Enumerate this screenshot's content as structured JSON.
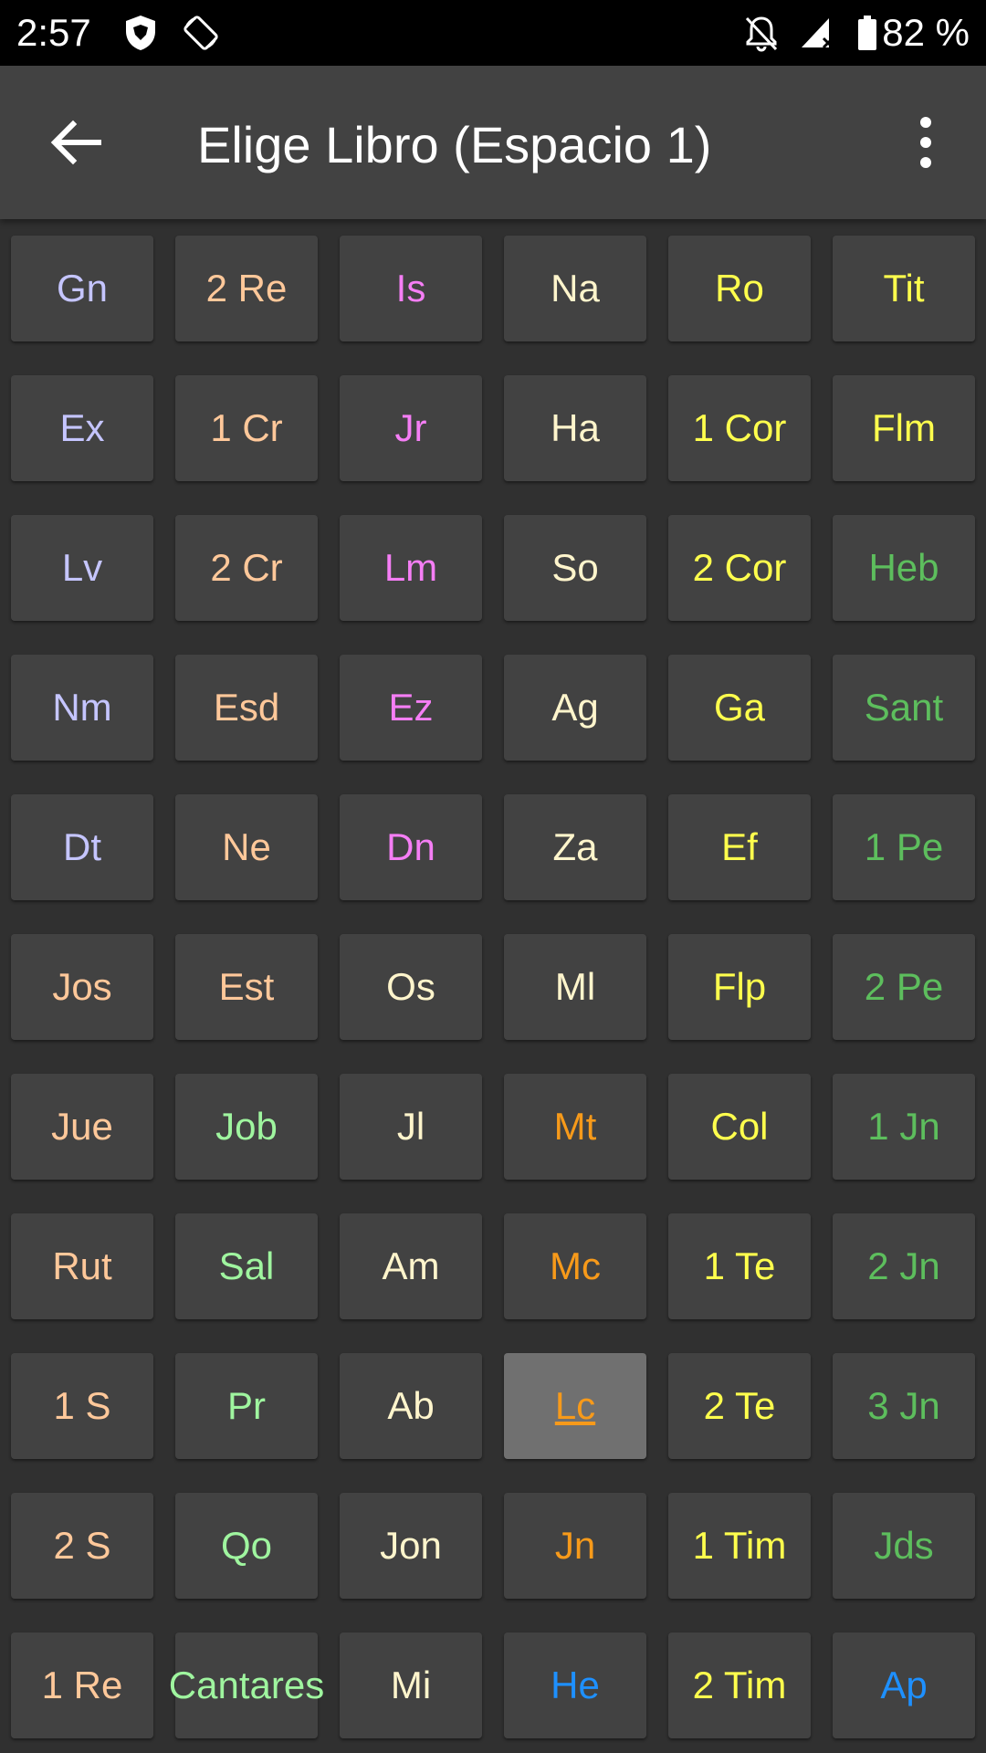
{
  "status_bar": {
    "time": "2:57",
    "icons": [
      "shield-app-icon",
      "screen-rotation-icon",
      "notifications-off-icon",
      "signal-icon",
      "battery-icon"
    ],
    "battery": "82 %"
  },
  "app_bar": {
    "title": "Elige Libro (Espacio 1)",
    "back_icon": "arrow-back-icon",
    "menu_icon": "more-vertical-icon"
  },
  "colors": {
    "lavender": "#C5C5FF",
    "peach": "#FFC89A",
    "pink": "#F57EF5",
    "cream": "#FFF5CC",
    "yellow": "#FFFF4D",
    "green": "#5DBE5D",
    "light_green": "#9FF59F",
    "orange": "#F79A1A",
    "blue": "#1E90FF"
  },
  "selected_book": "Lc",
  "books": [
    {
      "label": "Gn",
      "color": "#C5C5FF"
    },
    {
      "label": "2 Re",
      "color": "#FFC89A"
    },
    {
      "label": "Is",
      "color": "#F57EF5"
    },
    {
      "label": "Na",
      "color": "#FFF5CC"
    },
    {
      "label": "Ro",
      "color": "#FFFF4D"
    },
    {
      "label": "Tit",
      "color": "#FFFF4D"
    },
    {
      "label": "Ex",
      "color": "#C5C5FF"
    },
    {
      "label": "1 Cr",
      "color": "#FFC89A"
    },
    {
      "label": "Jr",
      "color": "#F57EF5"
    },
    {
      "label": "Ha",
      "color": "#FFF5CC"
    },
    {
      "label": "1 Cor",
      "color": "#FFFF4D"
    },
    {
      "label": "Flm",
      "color": "#FFFF4D"
    },
    {
      "label": "Lv",
      "color": "#C5C5FF"
    },
    {
      "label": "2 Cr",
      "color": "#FFC89A"
    },
    {
      "label": "Lm",
      "color": "#F57EF5"
    },
    {
      "label": "So",
      "color": "#FFF5CC"
    },
    {
      "label": "2 Cor",
      "color": "#FFFF4D"
    },
    {
      "label": "Heb",
      "color": "#5DBE5D"
    },
    {
      "label": "Nm",
      "color": "#C5C5FF"
    },
    {
      "label": "Esd",
      "color": "#FFC89A"
    },
    {
      "label": "Ez",
      "color": "#F57EF5"
    },
    {
      "label": "Ag",
      "color": "#FFF5CC"
    },
    {
      "label": "Ga",
      "color": "#FFFF4D"
    },
    {
      "label": "Sant",
      "color": "#5DBE5D"
    },
    {
      "label": "Dt",
      "color": "#C5C5FF"
    },
    {
      "label": "Ne",
      "color": "#FFC89A"
    },
    {
      "label": "Dn",
      "color": "#F57EF5"
    },
    {
      "label": "Za",
      "color": "#FFF5CC"
    },
    {
      "label": "Ef",
      "color": "#FFFF4D"
    },
    {
      "label": "1 Pe",
      "color": "#5DBE5D"
    },
    {
      "label": "Jos",
      "color": "#FFC89A"
    },
    {
      "label": "Est",
      "color": "#FFC89A"
    },
    {
      "label": "Os",
      "color": "#FFF5CC"
    },
    {
      "label": "Ml",
      "color": "#FFF5CC"
    },
    {
      "label": "Flp",
      "color": "#FFFF4D"
    },
    {
      "label": "2 Pe",
      "color": "#5DBE5D"
    },
    {
      "label": "Jue",
      "color": "#FFC89A"
    },
    {
      "label": "Job",
      "color": "#9FF59F"
    },
    {
      "label": "Jl",
      "color": "#FFF5CC"
    },
    {
      "label": "Mt",
      "color": "#F79A1A"
    },
    {
      "label": "Col",
      "color": "#FFFF4D"
    },
    {
      "label": "1 Jn",
      "color": "#5DBE5D"
    },
    {
      "label": "Rut",
      "color": "#FFC89A"
    },
    {
      "label": "Sal",
      "color": "#9FF59F"
    },
    {
      "label": "Am",
      "color": "#FFF5CC"
    },
    {
      "label": "Mc",
      "color": "#F79A1A"
    },
    {
      "label": "1 Te",
      "color": "#FFFF4D"
    },
    {
      "label": "2 Jn",
      "color": "#5DBE5D"
    },
    {
      "label": "1 S",
      "color": "#FFC89A"
    },
    {
      "label": "Pr",
      "color": "#9FF59F"
    },
    {
      "label": "Ab",
      "color": "#FFF5CC"
    },
    {
      "label": "Lc",
      "color": "#F79A1A"
    },
    {
      "label": "2 Te",
      "color": "#FFFF4D"
    },
    {
      "label": "3 Jn",
      "color": "#5DBE5D"
    },
    {
      "label": "2 S",
      "color": "#FFC89A"
    },
    {
      "label": "Qo",
      "color": "#9FF59F"
    },
    {
      "label": "Jon",
      "color": "#FFF5CC"
    },
    {
      "label": "Jn",
      "color": "#F79A1A"
    },
    {
      "label": "1 Tim",
      "color": "#FFFF4D"
    },
    {
      "label": "Jds",
      "color": "#5DBE5D"
    },
    {
      "label": "1 Re",
      "color": "#FFC89A"
    },
    {
      "label": "Cantares",
      "color": "#9FF59F"
    },
    {
      "label": "Mi",
      "color": "#FFF5CC"
    },
    {
      "label": "He",
      "color": "#1E90FF"
    },
    {
      "label": "2 Tim",
      "color": "#FFFF4D"
    },
    {
      "label": "Ap",
      "color": "#1E90FF"
    }
  ]
}
